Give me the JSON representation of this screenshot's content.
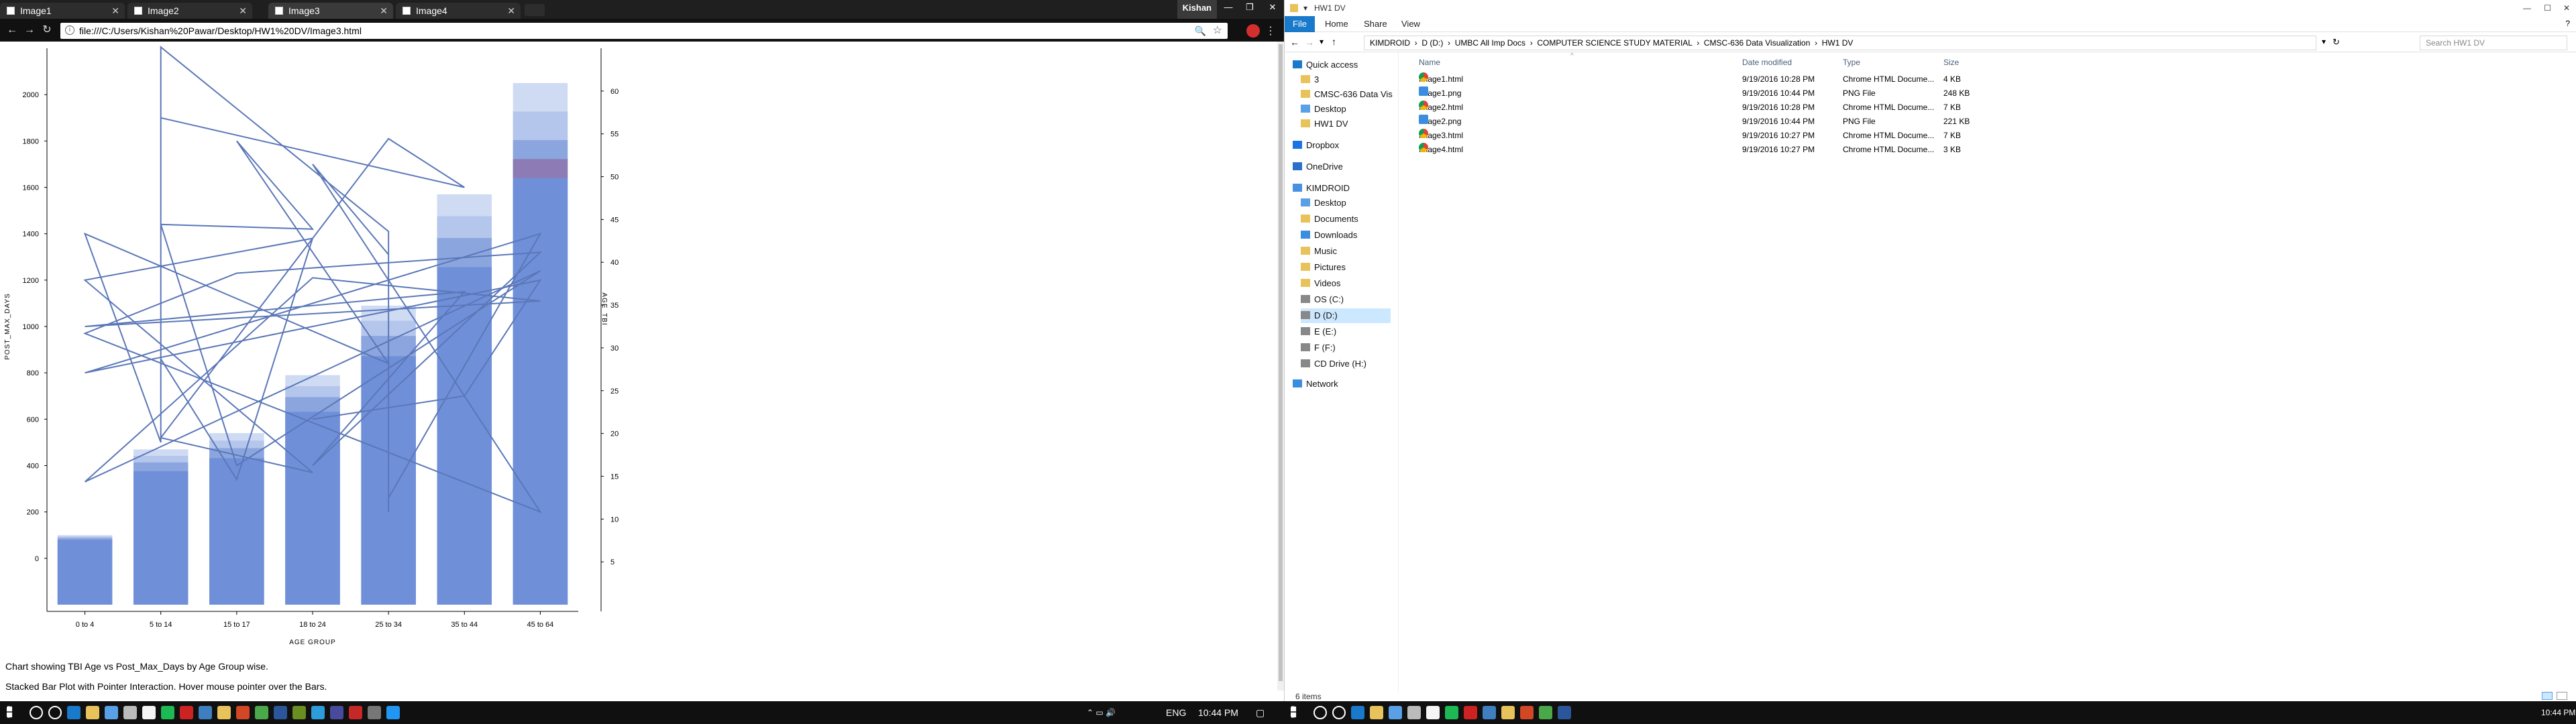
{
  "browser": {
    "tabs": [
      {
        "label": "Image1"
      },
      {
        "label": "Image2"
      },
      {
        "label": "Image3"
      },
      {
        "label": "Image4"
      }
    ],
    "active_tab_index": 2,
    "user_label": "Kishan",
    "url": "file:///C:/Users/Kishan%20Pawar/Desktop/HW1%20DV/Image3.html",
    "captions": [
      "Chart showing TBI Age vs Post_Max_Days by Age Group wise.",
      "Stacked Bar Plot with Pointer Interaction. Hover mouse pointer over the Bars."
    ]
  },
  "chart_data": {
    "type": "bar",
    "subtype": "stacked bar with line overlay",
    "xlabel": "AGE GROUP",
    "ylabel": "POST_MAX_DAYS",
    "y2label": "AGE_TBI",
    "categories": [
      "0 to 4",
      "5 to 14",
      "15 to 17",
      "18 to 24",
      "25 to 34",
      "35 to 44",
      "45 to 64"
    ],
    "stack_totals": [
      100,
      470,
      540,
      790,
      1090,
      1570,
      2050
    ],
    "ylim": [
      -200,
      2200
    ],
    "yticks": [
      0,
      200,
      400,
      600,
      800,
      1000,
      1200,
      1400,
      1600,
      1800,
      2000
    ],
    "y2lim": [
      0,
      65
    ],
    "y2ticks": [
      5,
      10,
      15,
      20,
      25,
      30,
      35,
      40,
      45,
      50,
      55,
      60
    ],
    "bar_colors": [
      "#6f8fd8",
      "#8ba5de",
      "#b5c6ec",
      "#cfdbf3"
    ],
    "highlight_color": "#8d7bb5",
    "line_color": "#5b77b8",
    "line_points": [
      [
        4,
        200
      ],
      [
        4,
        1410
      ],
      [
        1,
        2205
      ],
      [
        1,
        860
      ],
      [
        2,
        340
      ],
      [
        3,
        1380
      ],
      [
        0,
        1200
      ],
      [
        3,
        370
      ],
      [
        1,
        520
      ],
      [
        4,
        1810
      ],
      [
        5,
        1600
      ],
      [
        1,
        1900
      ],
      [
        1,
        500
      ],
      [
        0,
        1400
      ],
      [
        4,
        840
      ],
      [
        2,
        1800
      ],
      [
        3,
        1420
      ],
      [
        1,
        1440
      ],
      [
        2,
        400
      ],
      [
        6,
        1240
      ],
      [
        0,
        330
      ],
      [
        3,
        1210
      ],
      [
        6,
        1110
      ],
      [
        0,
        1000
      ],
      [
        5,
        1150
      ],
      [
        3,
        400
      ],
      [
        6,
        1320
      ],
      [
        2,
        1230
      ],
      [
        0,
        970
      ],
      [
        6,
        200
      ],
      [
        3,
        1700
      ],
      [
        4,
        1310
      ],
      [
        4,
        260
      ],
      [
        6,
        1400
      ],
      [
        0,
        800
      ],
      [
        6,
        1200
      ],
      [
        5,
        700
      ],
      [
        3,
        600
      ]
    ]
  },
  "explorer": {
    "title": "HW1 DV",
    "ribbon": [
      "File",
      "Home",
      "Share",
      "View"
    ],
    "path": [
      "KIMDROID",
      "D (D:)",
      "UMBC All Imp Docs",
      "COMPUTER SCIENCE STUDY MATERIAL",
      "CMSC-636 Data Visualization",
      "HW1 DV"
    ],
    "search_placeholder": "Search HW1 DV",
    "nav": [
      {
        "label": "Quick access",
        "level": 0,
        "color": "#1979ca"
      },
      {
        "label": "3",
        "level": 1,
        "color": "#e8c25b"
      },
      {
        "label": "CMSC-636 Data Vis",
        "level": 1,
        "color": "#e8c25b"
      },
      {
        "label": "Desktop",
        "level": 1,
        "color": "#5aa0e6"
      },
      {
        "label": "HW1 DV",
        "level": 1,
        "color": "#e8c25b"
      },
      {
        "label": "Dropbox",
        "level": 0,
        "color": "#1a73e8"
      },
      {
        "label": "OneDrive",
        "level": 0,
        "color": "#2a6fc9"
      },
      {
        "label": "KIMDROID",
        "level": 0,
        "color": "#4a90e2"
      },
      {
        "label": "Desktop",
        "level": 1,
        "color": "#5aa0e6"
      },
      {
        "label": "Documents",
        "level": 1,
        "color": "#e8c25b"
      },
      {
        "label": "Downloads",
        "level": 1,
        "color": "#3b8de0"
      },
      {
        "label": "Music",
        "level": 1,
        "color": "#e8c25b"
      },
      {
        "label": "Pictures",
        "level": 1,
        "color": "#e8c25b"
      },
      {
        "label": "Videos",
        "level": 1,
        "color": "#e8c25b"
      },
      {
        "label": "OS (C:)",
        "level": 1,
        "color": "#888888"
      },
      {
        "label": "D (D:)",
        "level": 1,
        "color": "#888888",
        "selected": true
      },
      {
        "label": "E (E:)",
        "level": 1,
        "color": "#888888"
      },
      {
        "label": "F (F:)",
        "level": 1,
        "color": "#888888"
      },
      {
        "label": "CD Drive (H:)",
        "level": 1,
        "color": "#888888"
      },
      {
        "label": "Network",
        "level": 0,
        "color": "#3b8de0"
      }
    ],
    "columns": [
      "Name",
      "Date modified",
      "Type",
      "Size"
    ],
    "files": [
      {
        "name": "Image1.html",
        "date": "9/19/2016 10:28 PM",
        "type": "Chrome HTML Docume...",
        "size": "4 KB",
        "kind": "html"
      },
      {
        "name": "Image1.png",
        "date": "9/19/2016 10:44 PM",
        "type": "PNG File",
        "size": "248 KB",
        "kind": "png"
      },
      {
        "name": "Image2.html",
        "date": "9/19/2016 10:28 PM",
        "type": "Chrome HTML Docume...",
        "size": "7 KB",
        "kind": "html"
      },
      {
        "name": "Image2.png",
        "date": "9/19/2016 10:44 PM",
        "type": "PNG File",
        "size": "221 KB",
        "kind": "png"
      },
      {
        "name": "Image3.html",
        "date": "9/19/2016 10:27 PM",
        "type": "Chrome HTML Docume...",
        "size": "7 KB",
        "kind": "html"
      },
      {
        "name": "Image4.html",
        "date": "9/19/2016 10:27 PM",
        "type": "Chrome HTML Docume...",
        "size": "3 KB",
        "kind": "html"
      }
    ],
    "status": "6 items"
  },
  "taskbar": {
    "language": "ENG",
    "clock_left": "10:44 PM",
    "clock_right": "10:44 PM",
    "pinned_colors": [
      "#888888",
      "#3b8de0",
      "#1979ca",
      "#e8c25b",
      "#5aa0e6",
      "#bbbbbb",
      "#f5f5f5",
      "#1db954",
      "#cc2222",
      "#3f7fbf",
      "#e8c25b",
      "#d24726",
      "#4aa84a",
      "#2b579a",
      "#6b8e23",
      "#2d9cdb",
      "#4a4a9c",
      "#c62828",
      "#777777",
      "#2196f3",
      "#8e24aa",
      "#e53935",
      "#2e7d32",
      "#5aa0e6",
      "#cc2222",
      "#f9a825",
      "#5c6bc0",
      "#1e88e5"
    ]
  }
}
